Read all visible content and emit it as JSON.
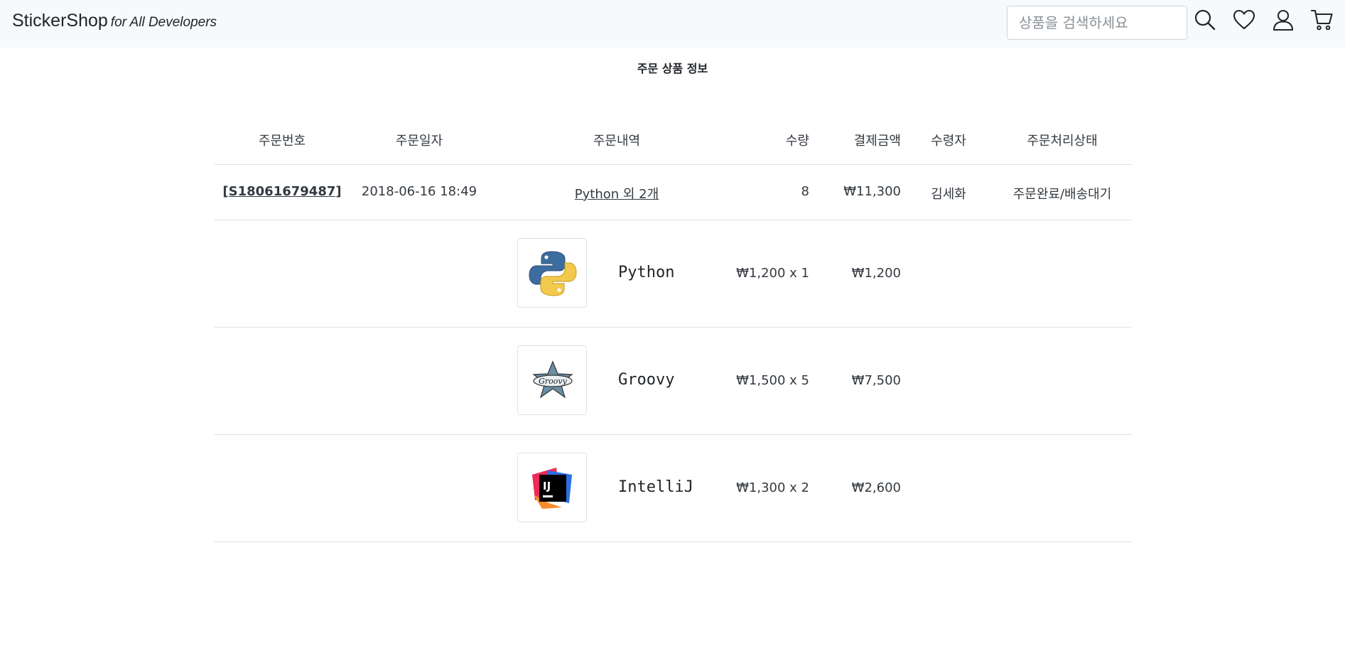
{
  "header": {
    "brand": "StickerShop",
    "tagline": "for All Developers",
    "search_placeholder": "상품을 검색하세요",
    "icons": [
      "search-icon",
      "heart-icon",
      "user-icon",
      "cart-icon"
    ]
  },
  "main": {
    "title": "주문 상품 정보",
    "columns": [
      "주문번호",
      "주문일자",
      "주문내역",
      "수량",
      "결제금액",
      "수령자",
      "주문처리상태"
    ],
    "order": {
      "number": "[S18061679487]",
      "date": "2018-06-16 18:49",
      "summary": "Python 외 2개",
      "quantity": "8",
      "amount": "₩11,300",
      "recipient": "김세화",
      "status": "주문완료/배송대기"
    },
    "items": [
      {
        "name": "Python",
        "unit_price": "₩1,200 x 1",
        "total": "₩1,200",
        "icon": "python-logo"
      },
      {
        "name": "Groovy",
        "unit_price": "₩1,500 x 5",
        "total": "₩7,500",
        "icon": "groovy-logo"
      },
      {
        "name": "IntelliJ",
        "unit_price": "₩1,300 x 2",
        "total": "₩2,600",
        "icon": "intellij-logo"
      }
    ]
  }
}
